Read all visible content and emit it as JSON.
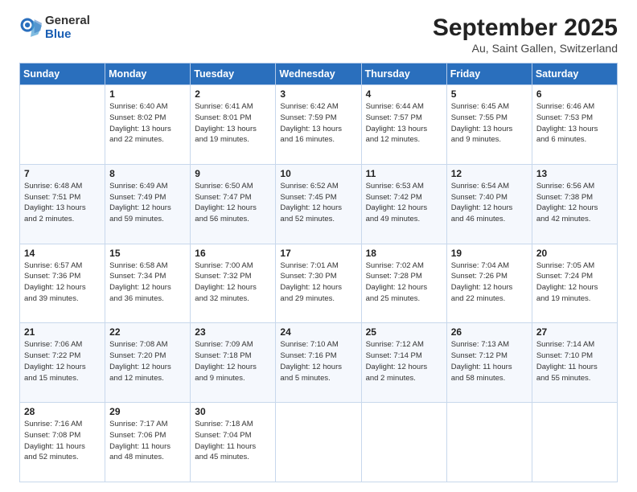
{
  "header": {
    "logo_general": "General",
    "logo_blue": "Blue",
    "title": "September 2025",
    "subtitle": "Au, Saint Gallen, Switzerland"
  },
  "weekdays": [
    "Sunday",
    "Monday",
    "Tuesday",
    "Wednesday",
    "Thursday",
    "Friday",
    "Saturday"
  ],
  "weeks": [
    [
      {
        "day": "",
        "info": ""
      },
      {
        "day": "1",
        "info": "Sunrise: 6:40 AM\nSunset: 8:02 PM\nDaylight: 13 hours\nand 22 minutes."
      },
      {
        "day": "2",
        "info": "Sunrise: 6:41 AM\nSunset: 8:01 PM\nDaylight: 13 hours\nand 19 minutes."
      },
      {
        "day": "3",
        "info": "Sunrise: 6:42 AM\nSunset: 7:59 PM\nDaylight: 13 hours\nand 16 minutes."
      },
      {
        "day": "4",
        "info": "Sunrise: 6:44 AM\nSunset: 7:57 PM\nDaylight: 13 hours\nand 12 minutes."
      },
      {
        "day": "5",
        "info": "Sunrise: 6:45 AM\nSunset: 7:55 PM\nDaylight: 13 hours\nand 9 minutes."
      },
      {
        "day": "6",
        "info": "Sunrise: 6:46 AM\nSunset: 7:53 PM\nDaylight: 13 hours\nand 6 minutes."
      }
    ],
    [
      {
        "day": "7",
        "info": "Sunrise: 6:48 AM\nSunset: 7:51 PM\nDaylight: 13 hours\nand 2 minutes."
      },
      {
        "day": "8",
        "info": "Sunrise: 6:49 AM\nSunset: 7:49 PM\nDaylight: 12 hours\nand 59 minutes."
      },
      {
        "day": "9",
        "info": "Sunrise: 6:50 AM\nSunset: 7:47 PM\nDaylight: 12 hours\nand 56 minutes."
      },
      {
        "day": "10",
        "info": "Sunrise: 6:52 AM\nSunset: 7:45 PM\nDaylight: 12 hours\nand 52 minutes."
      },
      {
        "day": "11",
        "info": "Sunrise: 6:53 AM\nSunset: 7:42 PM\nDaylight: 12 hours\nand 49 minutes."
      },
      {
        "day": "12",
        "info": "Sunrise: 6:54 AM\nSunset: 7:40 PM\nDaylight: 12 hours\nand 46 minutes."
      },
      {
        "day": "13",
        "info": "Sunrise: 6:56 AM\nSunset: 7:38 PM\nDaylight: 12 hours\nand 42 minutes."
      }
    ],
    [
      {
        "day": "14",
        "info": "Sunrise: 6:57 AM\nSunset: 7:36 PM\nDaylight: 12 hours\nand 39 minutes."
      },
      {
        "day": "15",
        "info": "Sunrise: 6:58 AM\nSunset: 7:34 PM\nDaylight: 12 hours\nand 36 minutes."
      },
      {
        "day": "16",
        "info": "Sunrise: 7:00 AM\nSunset: 7:32 PM\nDaylight: 12 hours\nand 32 minutes."
      },
      {
        "day": "17",
        "info": "Sunrise: 7:01 AM\nSunset: 7:30 PM\nDaylight: 12 hours\nand 29 minutes."
      },
      {
        "day": "18",
        "info": "Sunrise: 7:02 AM\nSunset: 7:28 PM\nDaylight: 12 hours\nand 25 minutes."
      },
      {
        "day": "19",
        "info": "Sunrise: 7:04 AM\nSunset: 7:26 PM\nDaylight: 12 hours\nand 22 minutes."
      },
      {
        "day": "20",
        "info": "Sunrise: 7:05 AM\nSunset: 7:24 PM\nDaylight: 12 hours\nand 19 minutes."
      }
    ],
    [
      {
        "day": "21",
        "info": "Sunrise: 7:06 AM\nSunset: 7:22 PM\nDaylight: 12 hours\nand 15 minutes."
      },
      {
        "day": "22",
        "info": "Sunrise: 7:08 AM\nSunset: 7:20 PM\nDaylight: 12 hours\nand 12 minutes."
      },
      {
        "day": "23",
        "info": "Sunrise: 7:09 AM\nSunset: 7:18 PM\nDaylight: 12 hours\nand 9 minutes."
      },
      {
        "day": "24",
        "info": "Sunrise: 7:10 AM\nSunset: 7:16 PM\nDaylight: 12 hours\nand 5 minutes."
      },
      {
        "day": "25",
        "info": "Sunrise: 7:12 AM\nSunset: 7:14 PM\nDaylight: 12 hours\nand 2 minutes."
      },
      {
        "day": "26",
        "info": "Sunrise: 7:13 AM\nSunset: 7:12 PM\nDaylight: 11 hours\nand 58 minutes."
      },
      {
        "day": "27",
        "info": "Sunrise: 7:14 AM\nSunset: 7:10 PM\nDaylight: 11 hours\nand 55 minutes."
      }
    ],
    [
      {
        "day": "28",
        "info": "Sunrise: 7:16 AM\nSunset: 7:08 PM\nDaylight: 11 hours\nand 52 minutes."
      },
      {
        "day": "29",
        "info": "Sunrise: 7:17 AM\nSunset: 7:06 PM\nDaylight: 11 hours\nand 48 minutes."
      },
      {
        "day": "30",
        "info": "Sunrise: 7:18 AM\nSunset: 7:04 PM\nDaylight: 11 hours\nand 45 minutes."
      },
      {
        "day": "",
        "info": ""
      },
      {
        "day": "",
        "info": ""
      },
      {
        "day": "",
        "info": ""
      },
      {
        "day": "",
        "info": ""
      }
    ]
  ]
}
